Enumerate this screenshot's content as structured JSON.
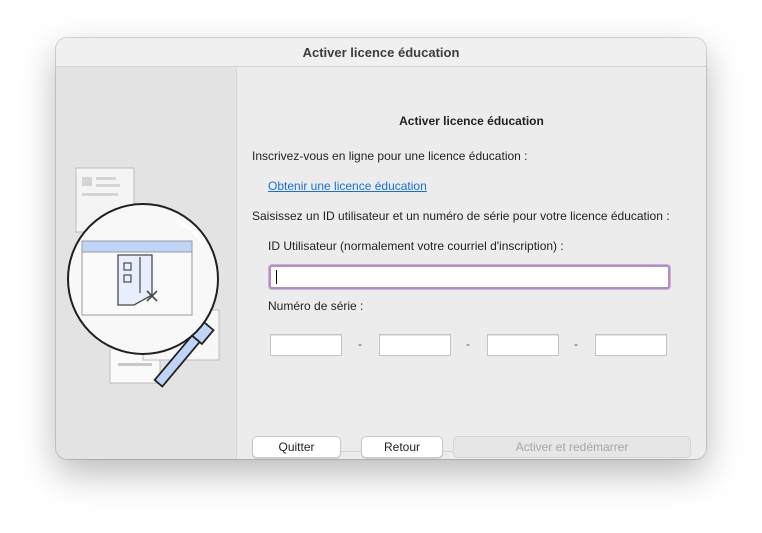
{
  "window": {
    "title": "Activer licence éducation"
  },
  "dialog": {
    "heading": "Activer licence éducation",
    "register_prompt": "Inscrivez-vous en ligne pour une licence éducation :",
    "register_link": "Obtenir une licence éducation",
    "enter_prompt": "Saisissez un ID utilisateur et un numéro de série pour votre licence éducation :",
    "user_id_label": "ID Utilisateur (normalement votre courriel d'inscription) :",
    "user_id_value": "",
    "serial_label": "Numéro de série :",
    "serial_parts": [
      "",
      "",
      "",
      ""
    ],
    "separator": "-"
  },
  "buttons": {
    "quit": "Quitter",
    "back": "Retour",
    "activate": "Activer et redémarrer"
  },
  "icons": {
    "illustration": "magnifier-document-icon"
  },
  "colors": {
    "focus_ring": "#b08fc3",
    "link": "#1a6ed8",
    "illustration_accent": "#c0d4f8"
  }
}
